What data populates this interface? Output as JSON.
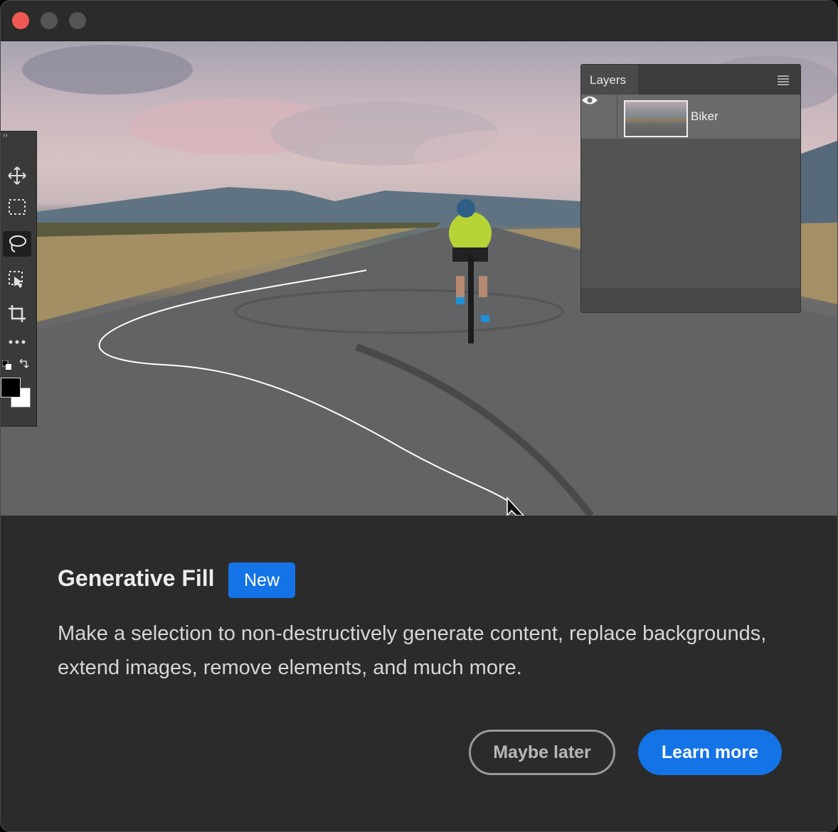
{
  "window": {
    "controls": [
      "close",
      "minimize",
      "maximize"
    ],
    "colors": {
      "close": "#ee5a52",
      "inactive": "#555555",
      "accent": "#1473e6"
    }
  },
  "toolbar": {
    "tools": [
      {
        "icon": "move-icon"
      },
      {
        "icon": "marquee-icon"
      },
      {
        "icon": "lasso-icon",
        "active": true
      },
      {
        "icon": "object-selection-icon"
      },
      {
        "icon": "crop-icon"
      },
      {
        "icon": "more-tools-icon"
      }
    ]
  },
  "layers_panel": {
    "tab_label": "Layers",
    "layers": [
      {
        "name": "Biker",
        "visible": true
      }
    ]
  },
  "dialog": {
    "title": "Generative Fill",
    "badge": "New",
    "description": "Make a selection to non-destructively generate content, replace backgrounds, extend images, remove elements, and much more.",
    "secondary_button": "Maybe later",
    "primary_button": "Learn more"
  }
}
